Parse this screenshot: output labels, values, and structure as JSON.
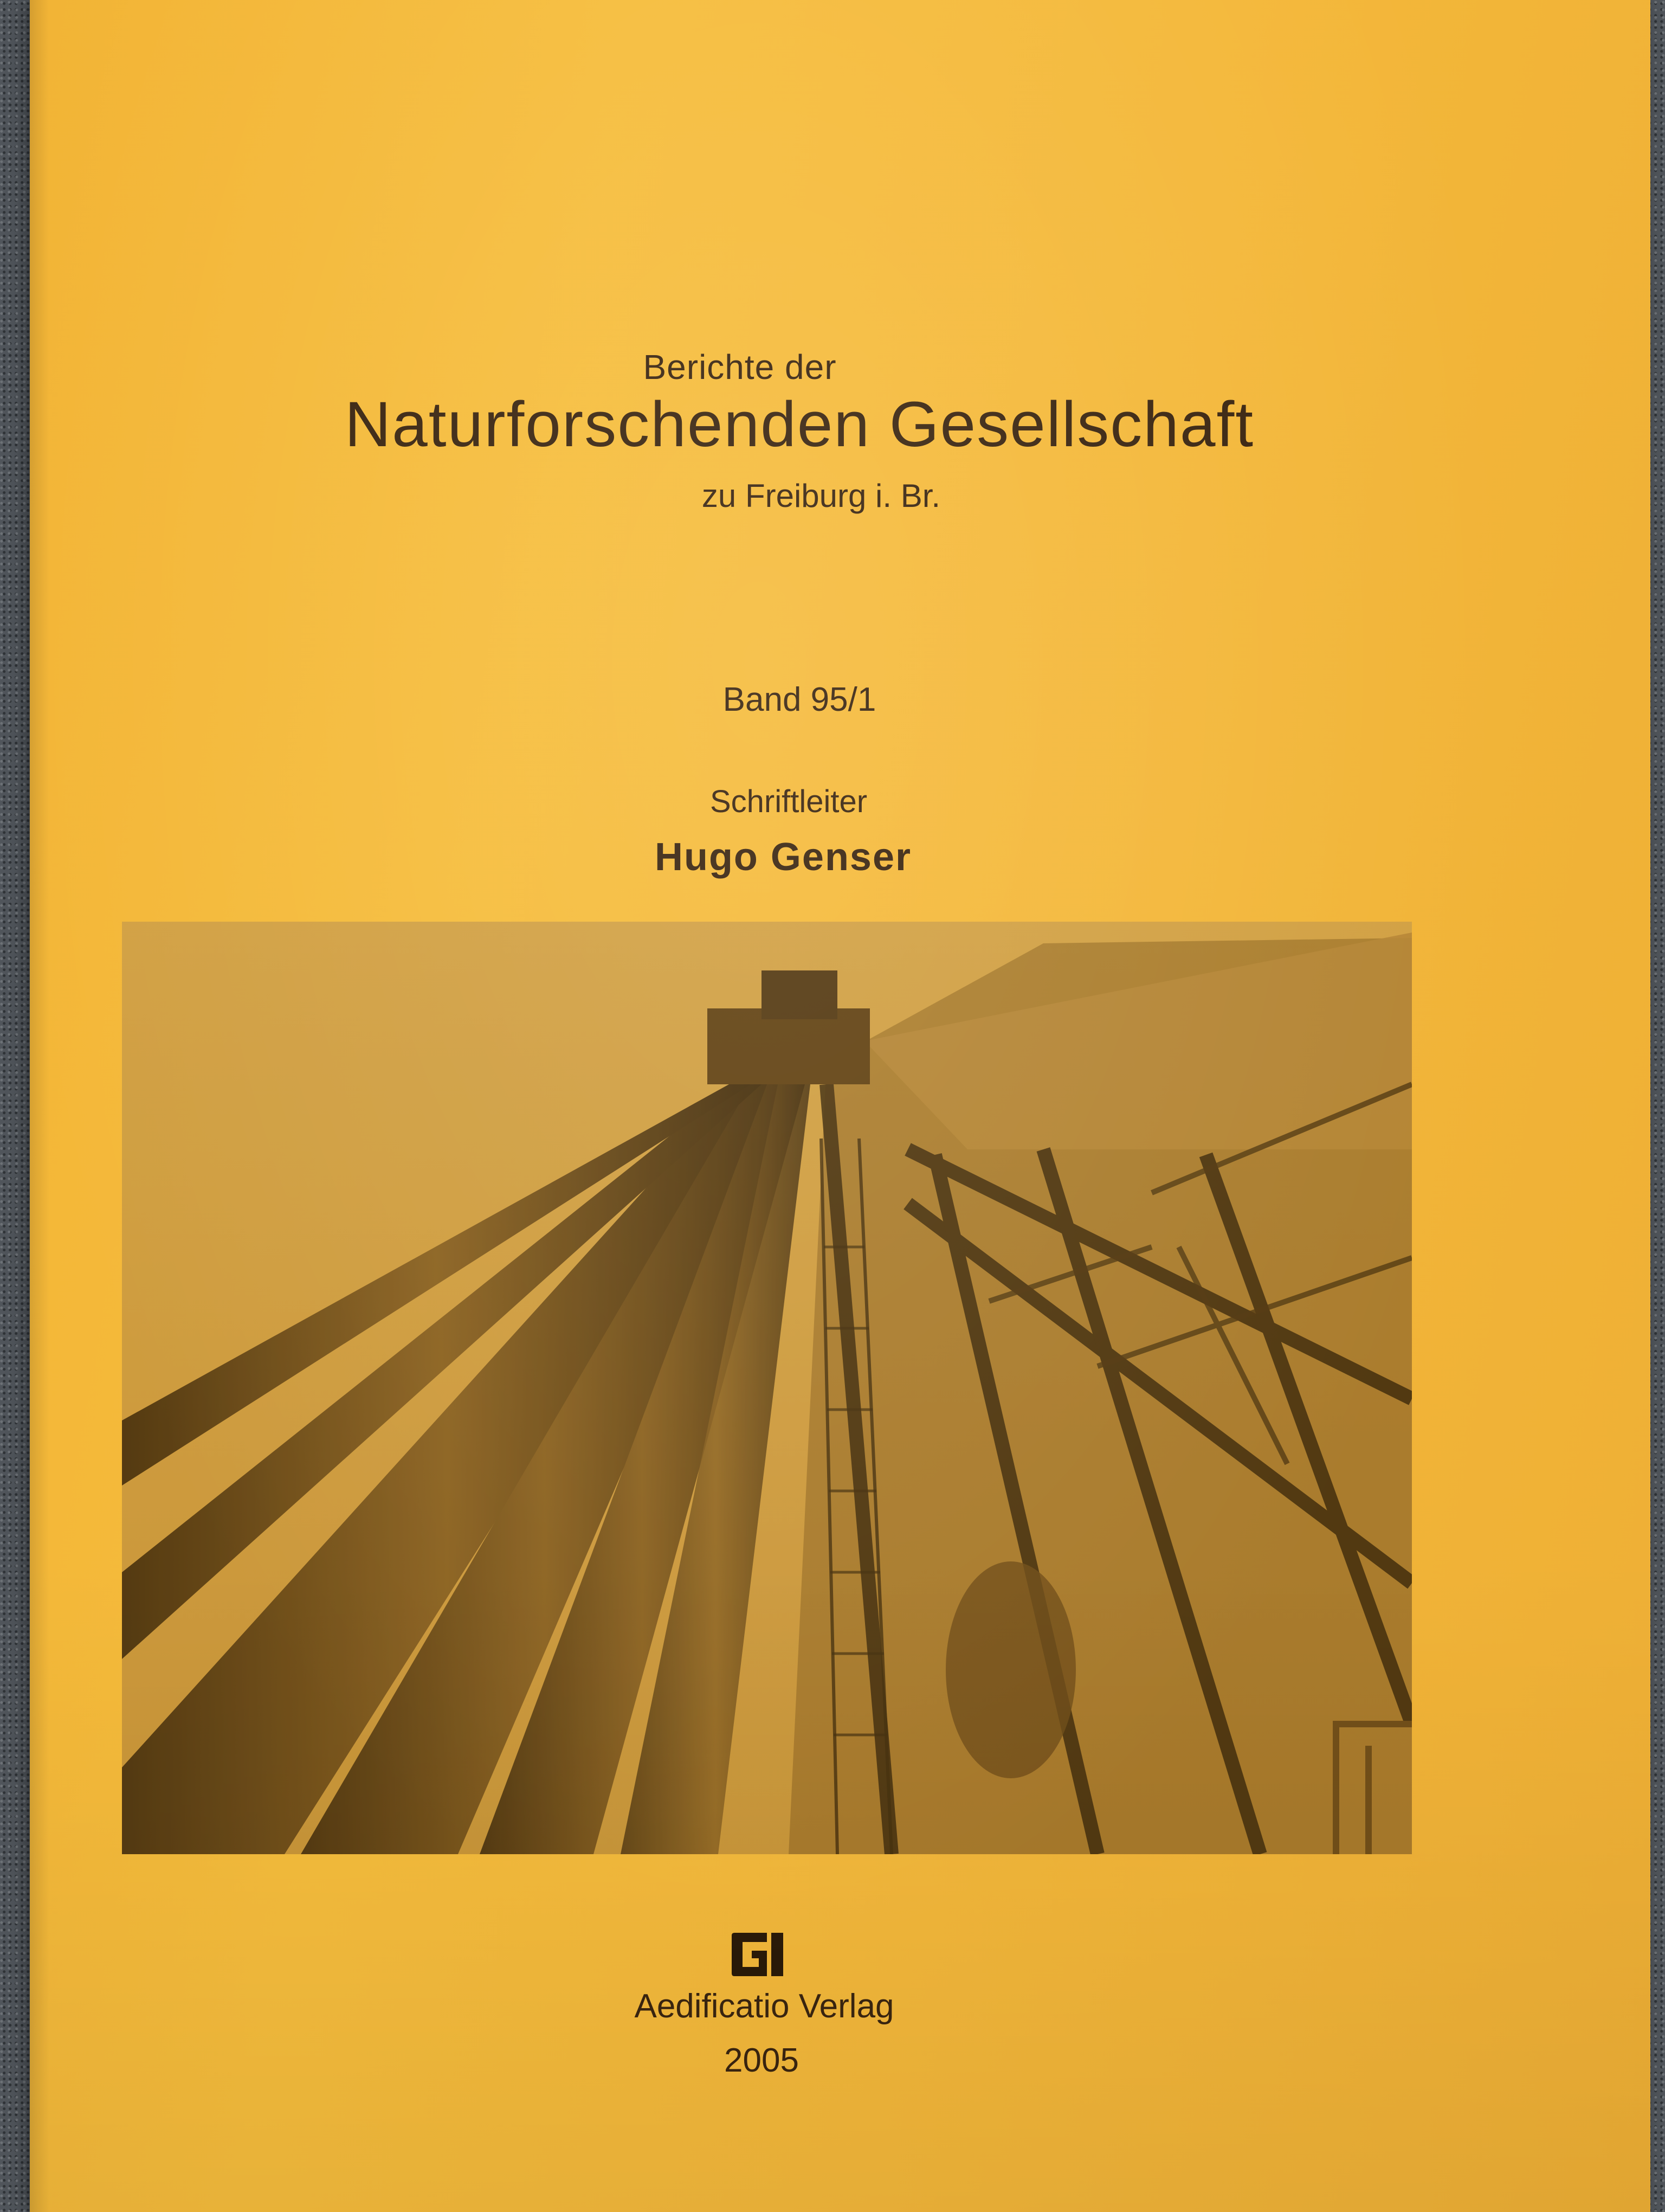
{
  "cover": {
    "series": "Berichte der",
    "society": "Naturforschenden Gesellschaft",
    "location": "zu Freiburg i. Br.",
    "volume": "Band 95/1",
    "editor_role": "Schriftleiter",
    "editor_name": "Hugo Genser",
    "publisher": "Aedificatio Verlag",
    "year": "2005"
  },
  "logo": {
    "icon": "publisher-logo-icon"
  },
  "photo": {
    "subject": "drilling-rig-photo",
    "tint": "#a8741f"
  },
  "colors": {
    "cover": "#f4b83a",
    "text": "#3a2510",
    "background": "#50555b"
  }
}
